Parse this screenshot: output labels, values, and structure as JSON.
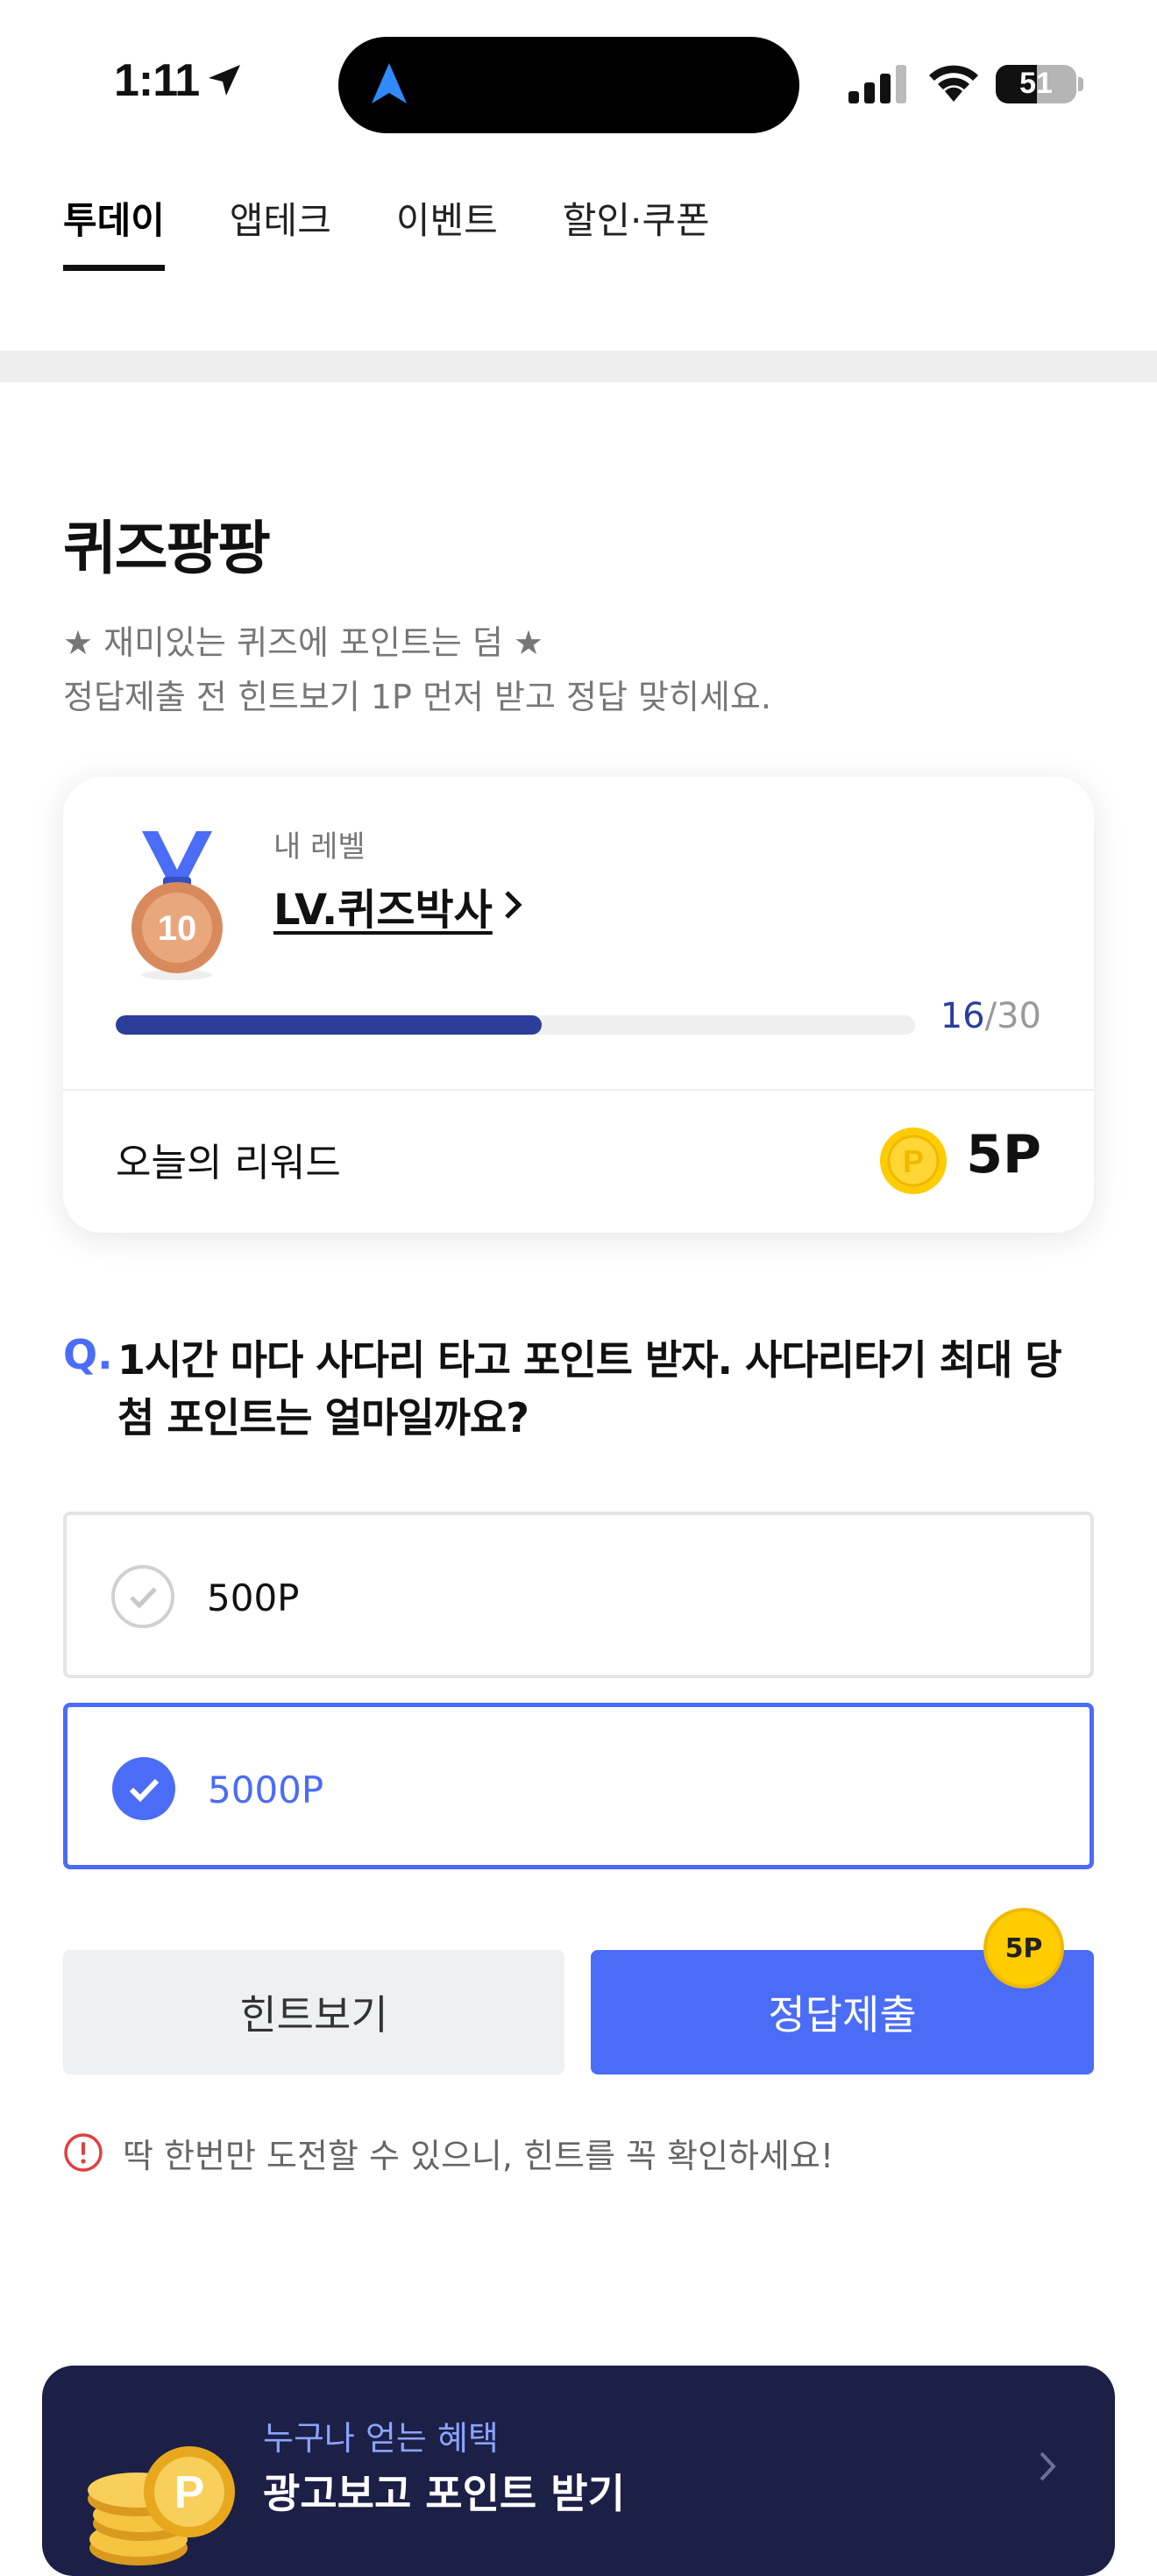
{
  "status_bar": {
    "time": "1:11",
    "battery": "51"
  },
  "tabs": [
    {
      "label": "투데이",
      "active": true
    },
    {
      "label": "앱테크",
      "active": false
    },
    {
      "label": "이벤트",
      "active": false
    },
    {
      "label": "할인·쿠폰",
      "active": false
    }
  ],
  "quiz": {
    "title": "퀴즈팡팡",
    "subtitle_line1": "★ 재미있는 퀴즈에 포인트는 덤 ★",
    "subtitle_line2": "정답제출 전 힌트보기 1P 먼저 받고 정답 맞히세요."
  },
  "level_card": {
    "caption": "내 레벨",
    "level_name": "LV.퀴즈박사",
    "medal_number": "10",
    "progress_current": "16",
    "progress_separator": "/",
    "progress_total": "30",
    "progress_fraction": 0.533,
    "reward_label": "오늘의 리워드",
    "reward_value": "5P",
    "coin_letter": "P"
  },
  "question": {
    "marker": "Q.",
    "text": "1시간 마다 사다리 타고 포인트 받자. 사다리타기 최대 당첨 포인트는 얼마일까요?"
  },
  "options": [
    {
      "label": "500P",
      "selected": false
    },
    {
      "label": "5000P",
      "selected": true
    }
  ],
  "buttons": {
    "hint": "힌트보기",
    "submit": "정답제출",
    "submit_badge": "5P"
  },
  "notice": "딱 한번만 도전할 수 있으니, 힌트를 꼭 확인하세요!",
  "banner": {
    "subtitle": "누구나 얻는 혜택",
    "title": "광고보고 포인트 받기",
    "coin_letter": "P"
  },
  "colors": {
    "accent": "#4a6cf7",
    "progress": "#2a3e9a",
    "coin": "#ffcc00",
    "banner_bg": "#1c1f46"
  }
}
